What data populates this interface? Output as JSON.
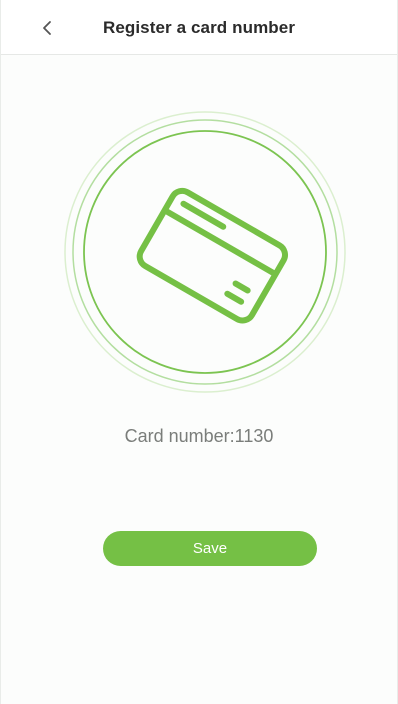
{
  "header": {
    "title": "Register a card number",
    "back_icon": "chevron-left-icon"
  },
  "main": {
    "card_icon": "credit-card-icon",
    "card_label": "Card number:",
    "card_value": "1130"
  },
  "actions": {
    "save_label": "Save"
  },
  "colors": {
    "accent": "#75c045",
    "ring_outer": "#d9efcc",
    "ring_mid": "#a5d98a",
    "ring_inner": "#7cc451",
    "text_secondary": "#7a7d7a"
  }
}
